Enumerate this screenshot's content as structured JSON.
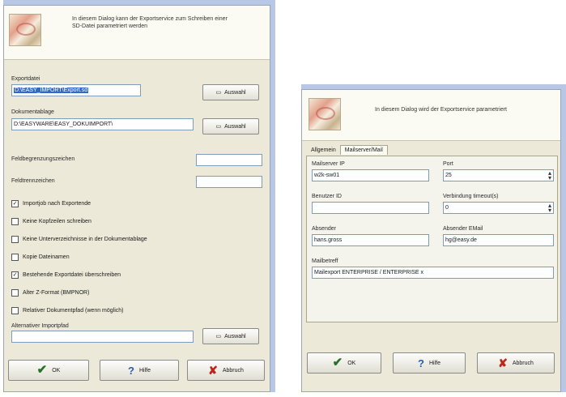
{
  "left": {
    "header_text": "In diesem Dialog kann der Exportservice zum Schreiben einer SD-Datei parametriert werden",
    "exportdatei_label": "Exportdatei",
    "exportdatei_value": "D:\\EASY_IMPORT\\Export.sd",
    "dokumentablage_label": "Dokumentablage",
    "dokumentablage_value": "D:\\EASYWARE\\EASY_DOKUIMPORT\\",
    "browse_label": "Auswahl",
    "feldbegrenzung_label": "Feldbegrenzungszeichen",
    "feldtrennzeichen_label": "Feldtrennzeichen",
    "checkboxes": [
      {
        "label": "Importjob nach Exportende",
        "checked": true
      },
      {
        "label": "Keine Kopfzeilen schreiben",
        "checked": false
      },
      {
        "label": "Keine Unterverzeichnisse in der Dokumentablage",
        "checked": false
      },
      {
        "label": "Kopie Dateinamen",
        "checked": false
      },
      {
        "label": "Bestehende Exportdatei überschreiben",
        "checked": true
      },
      {
        "label": "Alter Z-Format (BMPNOR)",
        "checked": false
      },
      {
        "label": "Relativer Dokumentpfad (wenn möglich)",
        "checked": false
      }
    ],
    "alt_import_label": "Alternativer Importpfad",
    "ok_label": "OK",
    "help_label": "Hilfe",
    "cancel_label": "Abbruch"
  },
  "right": {
    "header_text": "In diesem Dialog wird der Exportservice parametriert",
    "tabs": [
      "Allgemein",
      "Mailserver/Mail"
    ],
    "mailserver_ip_label": "Mailserver IP",
    "mailserver_ip_value": "w2k-sw01",
    "port_label": "Port",
    "port_value": "25",
    "benutzer_label": "Benutzer ID",
    "benutzer_value": "",
    "timeout_label": "Verbindung timeout(s)",
    "timeout_value": "0",
    "absender_label": "Absender",
    "absender_value": "hans.gross",
    "absender_email_label": "Absender EMail",
    "absender_email_value": "hg@easy.de",
    "mailbetreff_label": "Mailbetreff",
    "mailbetreff_value": "Mailexport ENTERPRISE / ENTERPRISE x",
    "ok_label": "OK",
    "help_label": "Hilfe",
    "cancel_label": "Abbruch"
  },
  "colors": {
    "dialog_bg": "#ece9d8",
    "selection": "#316ac5",
    "frame_blue": "#b9c7e6"
  },
  "icons": [
    "picture-logo-icon",
    "folder-browse-icon",
    "ok-check-icon",
    "help-question-icon",
    "cancel-x-icon"
  ]
}
